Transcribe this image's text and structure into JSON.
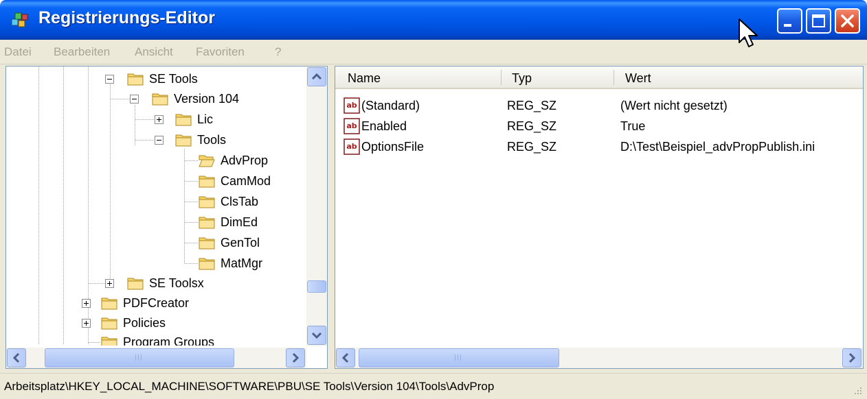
{
  "window": {
    "title": "Registrierungs-Editor"
  },
  "menu": {
    "items": [
      "Datei",
      "Bearbeiten",
      "Ansicht",
      "Favoriten",
      "?"
    ]
  },
  "tree": {
    "nodes": [
      {
        "label": "SE Tools",
        "state": "expanded"
      },
      {
        "label": "Version 104",
        "state": "expanded"
      },
      {
        "label": "Lic",
        "state": "collapsed"
      },
      {
        "label": "Tools",
        "state": "expanded"
      },
      {
        "label": "AdvProp",
        "state": "selected-open"
      },
      {
        "label": "CamMod",
        "state": "leaf"
      },
      {
        "label": "ClsTab",
        "state": "leaf"
      },
      {
        "label": "DimEd",
        "state": "leaf"
      },
      {
        "label": "GenTol",
        "state": "leaf"
      },
      {
        "label": "MatMgr",
        "state": "leaf"
      },
      {
        "label": "SE Toolsx",
        "state": "collapsed"
      },
      {
        "label": "PDFCreator",
        "state": "collapsed"
      },
      {
        "label": "Policies",
        "state": "collapsed"
      },
      {
        "label": "Program Groups",
        "state": "leaf"
      }
    ]
  },
  "list": {
    "columns": [
      "Name",
      "Typ",
      "Wert"
    ],
    "rows": [
      {
        "name": "(Standard)",
        "type": "REG_SZ",
        "value": "(Wert nicht gesetzt)"
      },
      {
        "name": "Enabled",
        "type": "REG_SZ",
        "value": "True"
      },
      {
        "name": "OptionsFile",
        "type": "REG_SZ",
        "value": "D:\\Test\\Beispiel_advPropPublish.ini"
      }
    ]
  },
  "status": {
    "path": "Arbeitsplatz\\HKEY_LOCAL_MACHINE\\SOFTWARE\\PBU\\SE Tools\\Version 104\\Tools\\AdvProp"
  },
  "icons": {
    "value_icon": "ab-string-icon",
    "folder": "folder-icon",
    "app": "registry-editor-icon"
  },
  "colors": {
    "titlebar": "#0055e5",
    "close_button": "#e25a3a",
    "menu_disabled_text": "#a7a596"
  }
}
